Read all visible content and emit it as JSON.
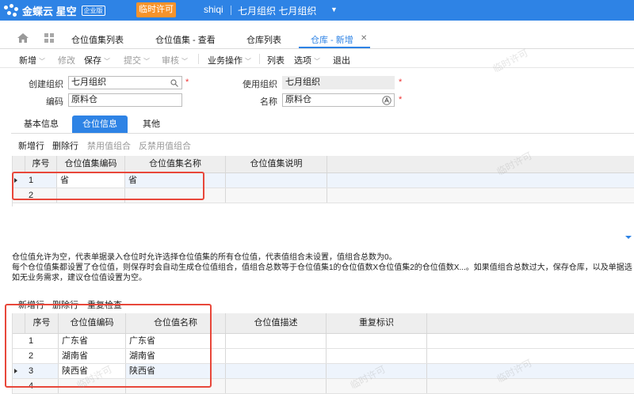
{
  "app": {
    "logo_text": "金蝶云 星空",
    "logo_badge": "企业版",
    "license_button": "临时许可",
    "user": "shiqi",
    "org": "七月组织  七月组织"
  },
  "tabs": [
    {
      "label": "仓位值集列表"
    },
    {
      "label": "仓位值集 - 查看"
    },
    {
      "label": "仓库列表"
    },
    {
      "label": "仓库 - 新增"
    }
  ],
  "tab_close": "✕",
  "toolbar": {
    "new": "新增",
    "modify": "修改",
    "save": "保存",
    "submit": "提交",
    "audit": "审核",
    "business": "业务操作",
    "list": "列表",
    "options": "选项",
    "exit": "退出"
  },
  "form": {
    "create_org_label": "创建组织",
    "create_org_value": "七月组织",
    "use_org_label": "使用组织",
    "use_org_value": "七月组织",
    "code_label": "编码",
    "code_value": "原料仓",
    "name_label": "名称",
    "name_value": "原料仓"
  },
  "subtabs": [
    "基本信息",
    "仓位信息",
    "其他"
  ],
  "actions1": {
    "add": "新增行",
    "delete": "删除行",
    "enable": "禁用值组合",
    "disable": "反禁用值组合"
  },
  "grid1": {
    "headers": [
      "序号",
      "仓位值集编码",
      "仓位值集名称",
      "仓位值集说明"
    ],
    "rows": [
      {
        "no": "1",
        "code": "省",
        "name": "省",
        "desc": ""
      },
      {
        "no": "2",
        "code": "",
        "name": "",
        "desc": ""
      }
    ]
  },
  "notes": [
    "仓位值允许为空，代表单据录入仓位时允许选择仓位值集的所有仓位值，代表值组合未设置，值组合总数为0。",
    "每个仓位值集都设置了仓位值，则保存时会自动生成仓位值组合，值组合总数等于仓位值集1的仓位值数X仓位值集2的仓位值数X...。如果值组合总数过大，保存仓库，以及单据选",
    "如无业务需求，建议仓位值设置为空。"
  ],
  "actions2": {
    "add": "新增行",
    "delete": "删除行",
    "dup": "重复检查"
  },
  "grid2": {
    "headers": [
      "序号",
      "仓位值编码",
      "仓位值名称",
      "仓位值描述",
      "重复标识"
    ],
    "rows": [
      {
        "no": "1",
        "code": "广东省",
        "name": "广东省",
        "desc": "",
        "dup": ""
      },
      {
        "no": "2",
        "code": "湖南省",
        "name": "湖南省",
        "desc": "",
        "dup": ""
      },
      {
        "no": "3",
        "code": "陕西省",
        "name": "陕西省",
        "desc": "",
        "dup": ""
      },
      {
        "no": "4",
        "code": "",
        "name": "",
        "desc": "",
        "dup": ""
      }
    ]
  },
  "watermark": "临时许可"
}
